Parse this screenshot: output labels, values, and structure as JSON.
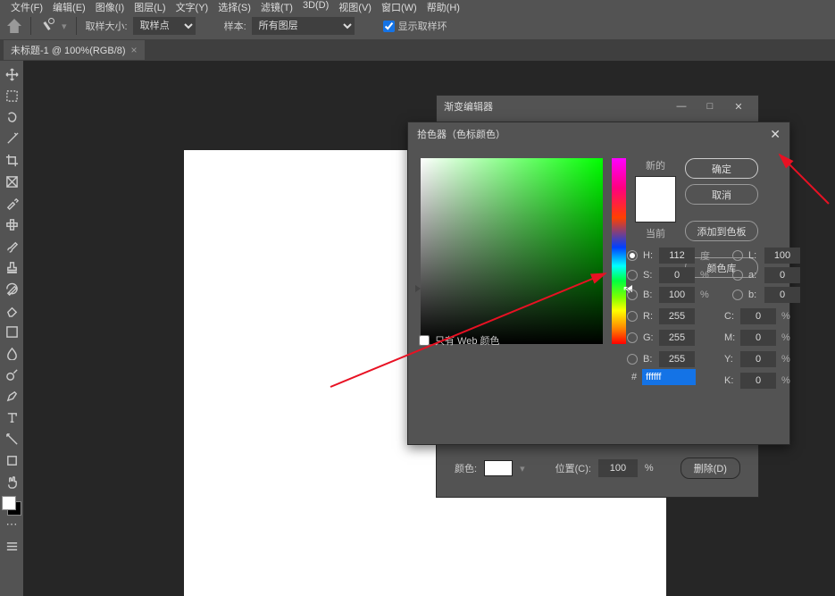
{
  "menu": [
    "文件(F)",
    "编辑(E)",
    "图像(I)",
    "图层(L)",
    "文字(Y)",
    "选择(S)",
    "滤镜(T)",
    "3D(D)",
    "视图(V)",
    "窗口(W)",
    "帮助(H)"
  ],
  "options": {
    "sample_size_label": "取样大小:",
    "sample_size_value": "取样点",
    "sample_layer_label": "样本:",
    "sample_layer_value": "所有图层",
    "show_ring_label": "显示取样环"
  },
  "tab": {
    "title": "未标题-1 @ 100%(RGB/8)"
  },
  "gradient_dialog": {
    "title": "渐变编辑器",
    "color_label": "颜色:",
    "position_label": "位置(C):",
    "position_value": "100",
    "position_unit": "%",
    "delete_btn": "删除(D)"
  },
  "picker": {
    "title": "拾色器（色标颜色）",
    "new_label": "新的",
    "current_label": "当前",
    "ok": "确定",
    "cancel": "取消",
    "add_swatch": "添加到色板",
    "color_lib": "颜色库",
    "web_only": "只有 Web 颜色",
    "hsb": {
      "H": {
        "label": "H:",
        "value": "112",
        "unit": "度"
      },
      "S": {
        "label": "S:",
        "value": "0",
        "unit": "%"
      },
      "B": {
        "label": "B:",
        "value": "100",
        "unit": "%"
      }
    },
    "lab": {
      "L": {
        "label": "L:",
        "value": "100"
      },
      "a": {
        "label": "a:",
        "value": "0"
      },
      "b": {
        "label": "b:",
        "value": "0"
      }
    },
    "rgb": {
      "R": {
        "label": "R:",
        "value": "255"
      },
      "G": {
        "label": "G:",
        "value": "255"
      },
      "B": {
        "label": "B:",
        "value": "255"
      }
    },
    "cmyk": {
      "C": {
        "label": "C:",
        "value": "0",
        "unit": "%"
      },
      "M": {
        "label": "M:",
        "value": "0",
        "unit": "%"
      },
      "Y": {
        "label": "Y:",
        "value": "0",
        "unit": "%"
      },
      "K": {
        "label": "K:",
        "value": "0",
        "unit": "%"
      }
    },
    "hex_label": "#",
    "hex_value": "ffffff"
  }
}
